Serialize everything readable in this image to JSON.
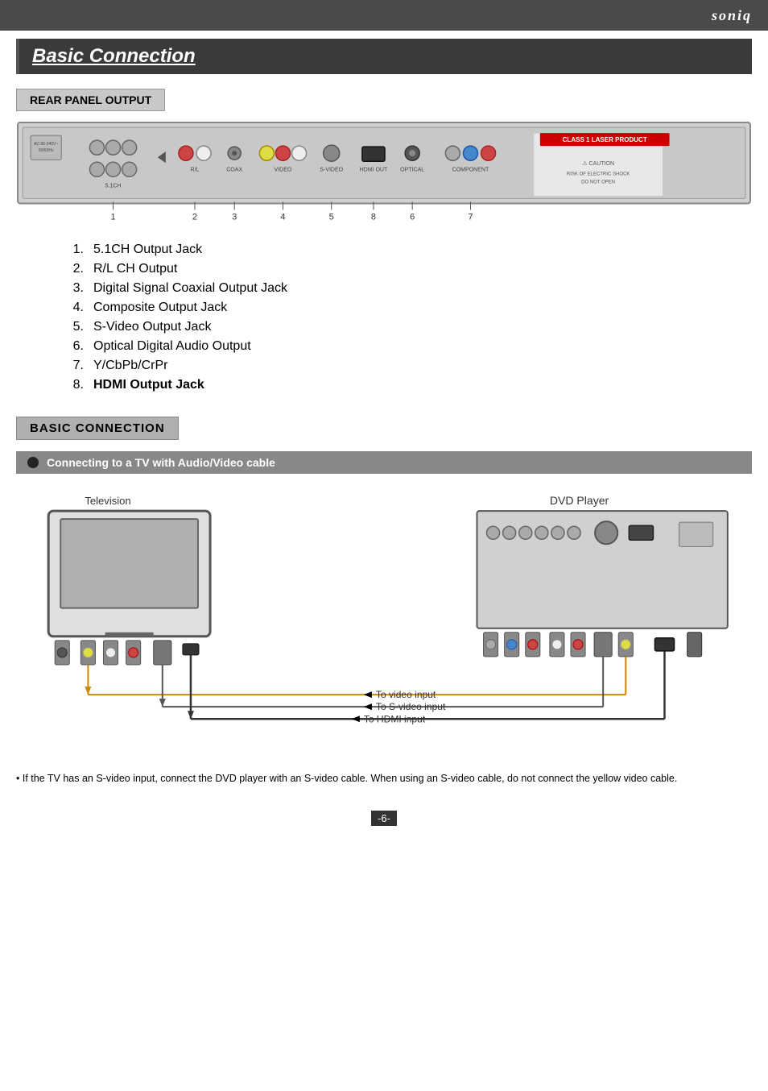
{
  "brand": "soniq",
  "page_title": "Basic Connection",
  "sections": {
    "rear_panel": {
      "label": "REAR PANEL OUTPUT",
      "items": [
        {
          "num": "1",
          "text": "5.1CH Output Jack"
        },
        {
          "num": "2",
          "text": "R/L CH Output"
        },
        {
          "num": "3",
          "text": "Digital Signal Coaxial Output Jack"
        },
        {
          "num": "4",
          "text": "Composite Output Jack"
        },
        {
          "num": "5",
          "text": "S-Video Output Jack"
        },
        {
          "num": "6",
          "text": "Optical Digital Audio Output"
        },
        {
          "num": "7",
          "text": "Y/CbPb/CrPr"
        },
        {
          "num": "8",
          "text": "HDMI Output Jack"
        }
      ]
    },
    "basic_connection": {
      "label": "BASIC CONNECTION",
      "sub_label": "Connecting to a TV with Audio/Video cable",
      "tv_label": "Television",
      "dvd_label": "DVD Player",
      "cable_labels": [
        "To video input",
        "To S-video input",
        "To HDMI input"
      ],
      "note": "If the TV has an S-video input, connect the DVD player with an S-video cable.\n    When using an S-video cable, do not connect the yellow video cable."
    }
  },
  "page_number": "-6-"
}
